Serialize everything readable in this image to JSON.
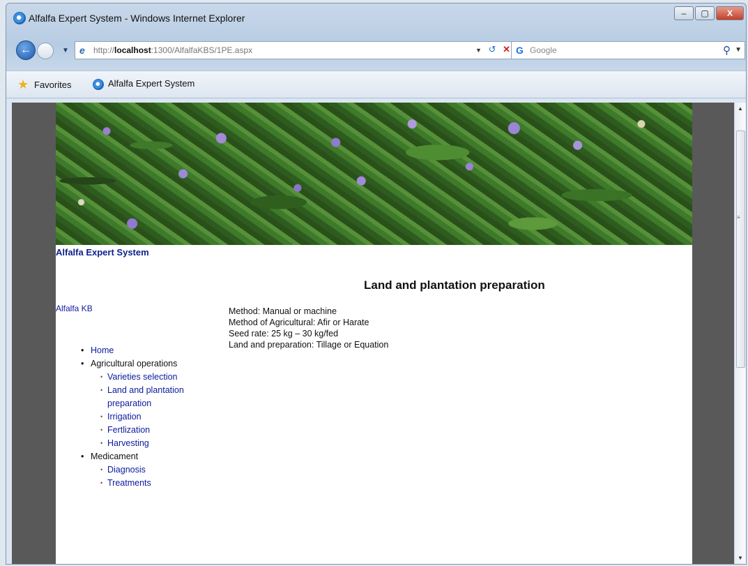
{
  "window": {
    "title": "Alfalfa Expert System - Windows Internet Explorer",
    "minimize": "–",
    "maximize": "▢",
    "close": "X"
  },
  "address_bar": {
    "url_prefix": "http://",
    "url_host": "localhost",
    "url_path": ":1300/AlfalfaKBS/1PE.aspx",
    "refresh": "↺",
    "stop": "✕"
  },
  "search": {
    "engine_icon": "G",
    "placeholder": "Google"
  },
  "favorites_bar": {
    "favorites_label": "Favorites",
    "tab_label": "Alfalfa Expert System"
  },
  "page": {
    "site_name": "Alfalfa Expert System",
    "kb_link": "Alfalfa KB",
    "title": "Land and plantation preparation",
    "details": [
      "Method: Manual or machine",
      "Method of Agricultural: Afir or Harate",
      "Seed rate: 25 kg – 30 kg/fed",
      "Land and preparation: Tillage or Equation"
    ],
    "nav": {
      "home": "Home",
      "agricultural_operations": {
        "label": "Agricultural operations",
        "items": [
          "Varieties selection",
          "Land and plantation preparation",
          "Irrigation",
          "Fertlization",
          "Harvesting"
        ]
      },
      "medicament": {
        "label": "Medicament",
        "items": [
          "Diagnosis",
          "Treatments"
        ]
      }
    }
  },
  "icons": {
    "back": "back-arrow-icon",
    "forward": "forward-arrow-icon",
    "favorites": "star-icon",
    "search": "magnifier-icon"
  }
}
